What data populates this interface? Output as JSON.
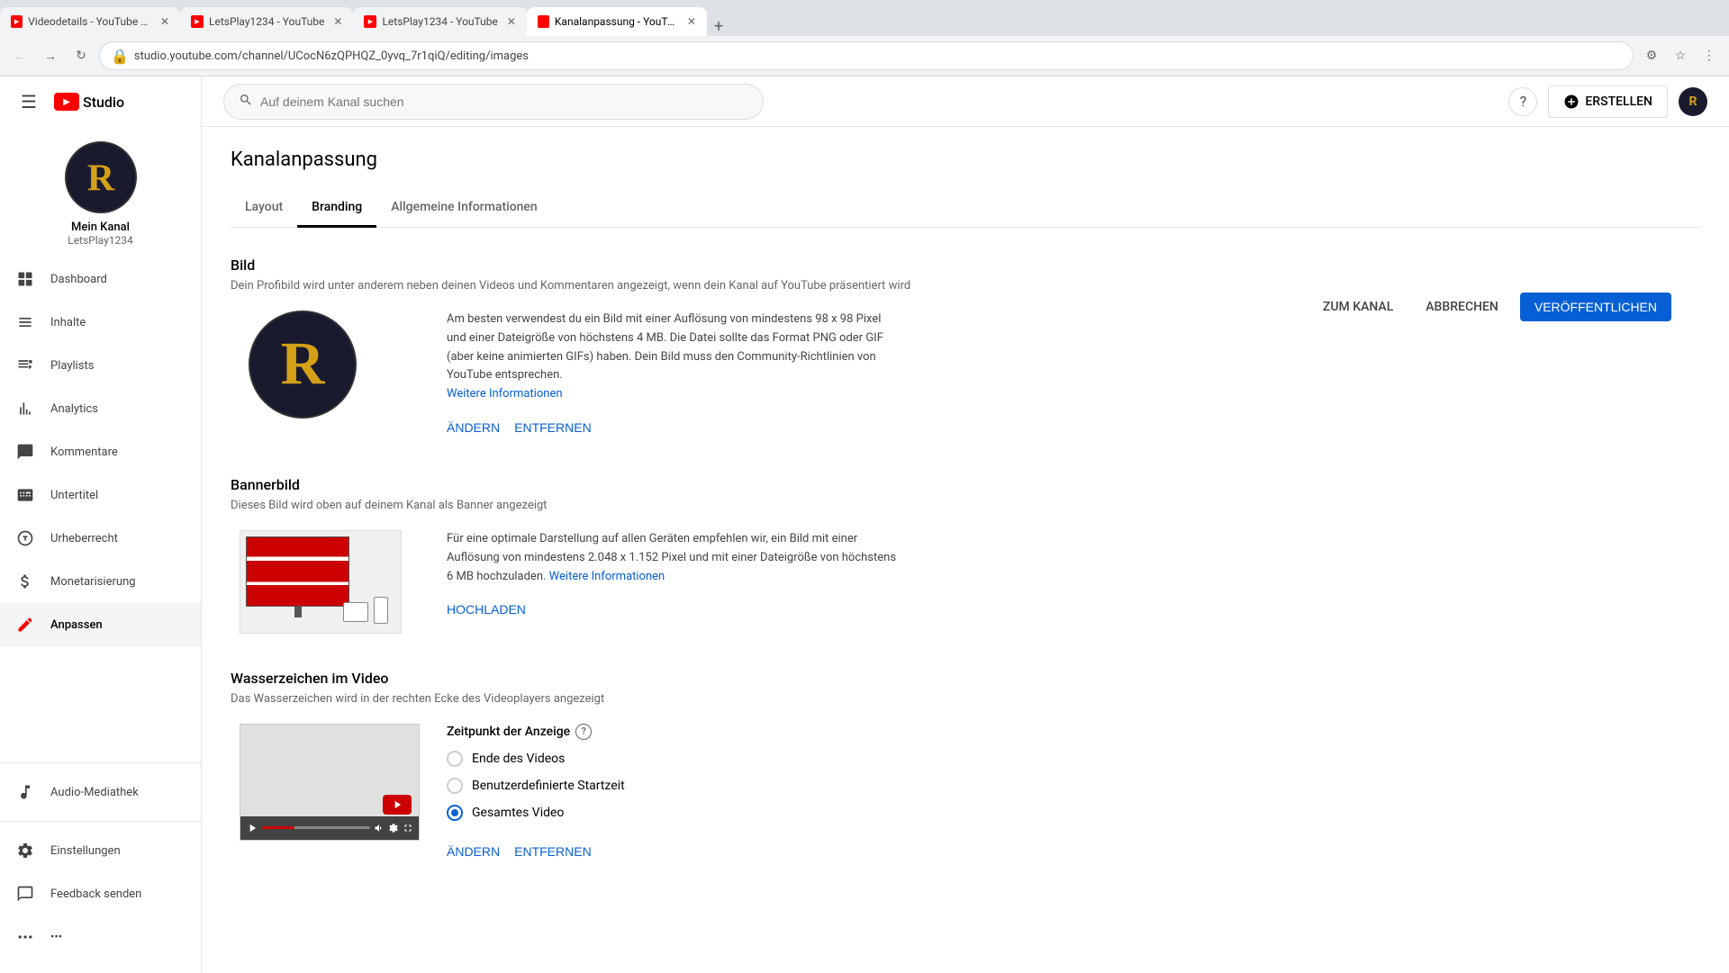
{
  "browser": {
    "tabs": [
      {
        "label": "Videodetails - YouTube St...",
        "favicon": "yt",
        "active": false
      },
      {
        "label": "LetsPlay1234 - YouTube",
        "favicon": "yt",
        "active": false
      },
      {
        "label": "LetsPlay1234 - YouTube",
        "favicon": "yt",
        "active": false
      },
      {
        "label": "Kanalanpassung - YouTub...",
        "favicon": "studio",
        "active": true
      }
    ],
    "address": "studio.youtube.com/channel/UCocN6zQPHQZ_0yvq_7r1qiQ/editing/images"
  },
  "topbar": {
    "search_placeholder": "Auf deinem Kanal suchen",
    "create_label": "ERSTELLEN",
    "help_icon": "?"
  },
  "sidebar": {
    "channel_name": "Mein Kanal",
    "channel_handle": "LetsPlay1234",
    "nav_items": [
      {
        "id": "dashboard",
        "label": "Dashboard",
        "icon": "⊞"
      },
      {
        "id": "inhalte",
        "label": "Inhalte",
        "icon": "▶"
      },
      {
        "id": "playlists",
        "label": "Playlists",
        "icon": "☰"
      },
      {
        "id": "analytics",
        "label": "Analytics",
        "icon": "📊"
      },
      {
        "id": "kommentare",
        "label": "Kommentare",
        "icon": "💬"
      },
      {
        "id": "untertitel",
        "label": "Untertitel",
        "icon": "CC"
      },
      {
        "id": "urheberrecht",
        "label": "Urheberrecht",
        "icon": "©"
      },
      {
        "id": "monetarisierung",
        "label": "Monetarisierung",
        "icon": "$"
      },
      {
        "id": "anpassen",
        "label": "Anpassen",
        "icon": "✏",
        "active": true
      }
    ],
    "footer_items": [
      {
        "id": "audio-mediathek",
        "label": "Audio-Mediathek",
        "icon": "♪"
      },
      {
        "id": "einstellungen",
        "label": "Einstellungen",
        "icon": "⚙"
      },
      {
        "id": "feedback",
        "label": "Feedback senden",
        "icon": "✉"
      },
      {
        "id": "more",
        "label": "...",
        "icon": "•••"
      }
    ]
  },
  "page": {
    "title": "Kanalanpassung",
    "actions": {
      "zum_kanal": "ZUM KANAL",
      "abbrechen": "ABBRECHEN",
      "veroeffentlichen": "VERÖFFENTLICHEN"
    },
    "tabs": [
      {
        "id": "layout",
        "label": "Layout",
        "active": false
      },
      {
        "id": "branding",
        "label": "Branding",
        "active": true
      },
      {
        "id": "allgemeine",
        "label": "Allgemeine Informationen",
        "active": false
      }
    ],
    "bild": {
      "title": "Bild",
      "desc": "Dein Profibild wird unter anderem neben deinen Videos und Kommentaren angezeigt, wenn dein Kanal auf YouTube präsentiert wird",
      "info": "Am besten verwendest du ein Bild mit einer Auflösung von mindestens 98 x 98 Pixel und einer Dateigröße von höchstens 4 MB. Die Datei sollte das Format PNG oder GIF (aber keine animierten GIFs) haben. Dein Bild muss den Community-Richtlinien von YouTube entsprechen.",
      "link": "Weitere Informationen",
      "btn_aendern": "ÄNDERN",
      "btn_entfernen": "ENTFERNEN"
    },
    "bannerbild": {
      "title": "Bannerbild",
      "desc": "Dieses Bild wird oben auf deinem Kanal als Banner angezeigt",
      "info": "Für eine optimale Darstellung auf allen Geräten empfehlen wir, ein Bild mit einer Auflösung von mindestens 2.048 x 1.152 Pixel und mit einer Dateigröße von höchstens 6 MB hochzuladen.",
      "link": "Weitere Informationen",
      "btn_hochladen": "HOCHLADEN"
    },
    "wasserzeichen": {
      "title": "Wasserzeichen im Video",
      "desc": "Das Wasserzeichen wird in der rechten Ecke des Videoplayers angezeigt",
      "zeitpunkt_label": "Zeitpunkt der Anzeige",
      "options": [
        {
          "id": "ende",
          "label": "Ende des Videos",
          "checked": false
        },
        {
          "id": "benutzerdefiniert",
          "label": "Benutzerdefinierte Startzeit",
          "checked": false
        },
        {
          "id": "gesamtes",
          "label": "Gesamtes Video",
          "checked": true
        }
      ],
      "btn_aendern": "ÄNDERN",
      "btn_entfernen": "ENTFERNEN"
    }
  }
}
